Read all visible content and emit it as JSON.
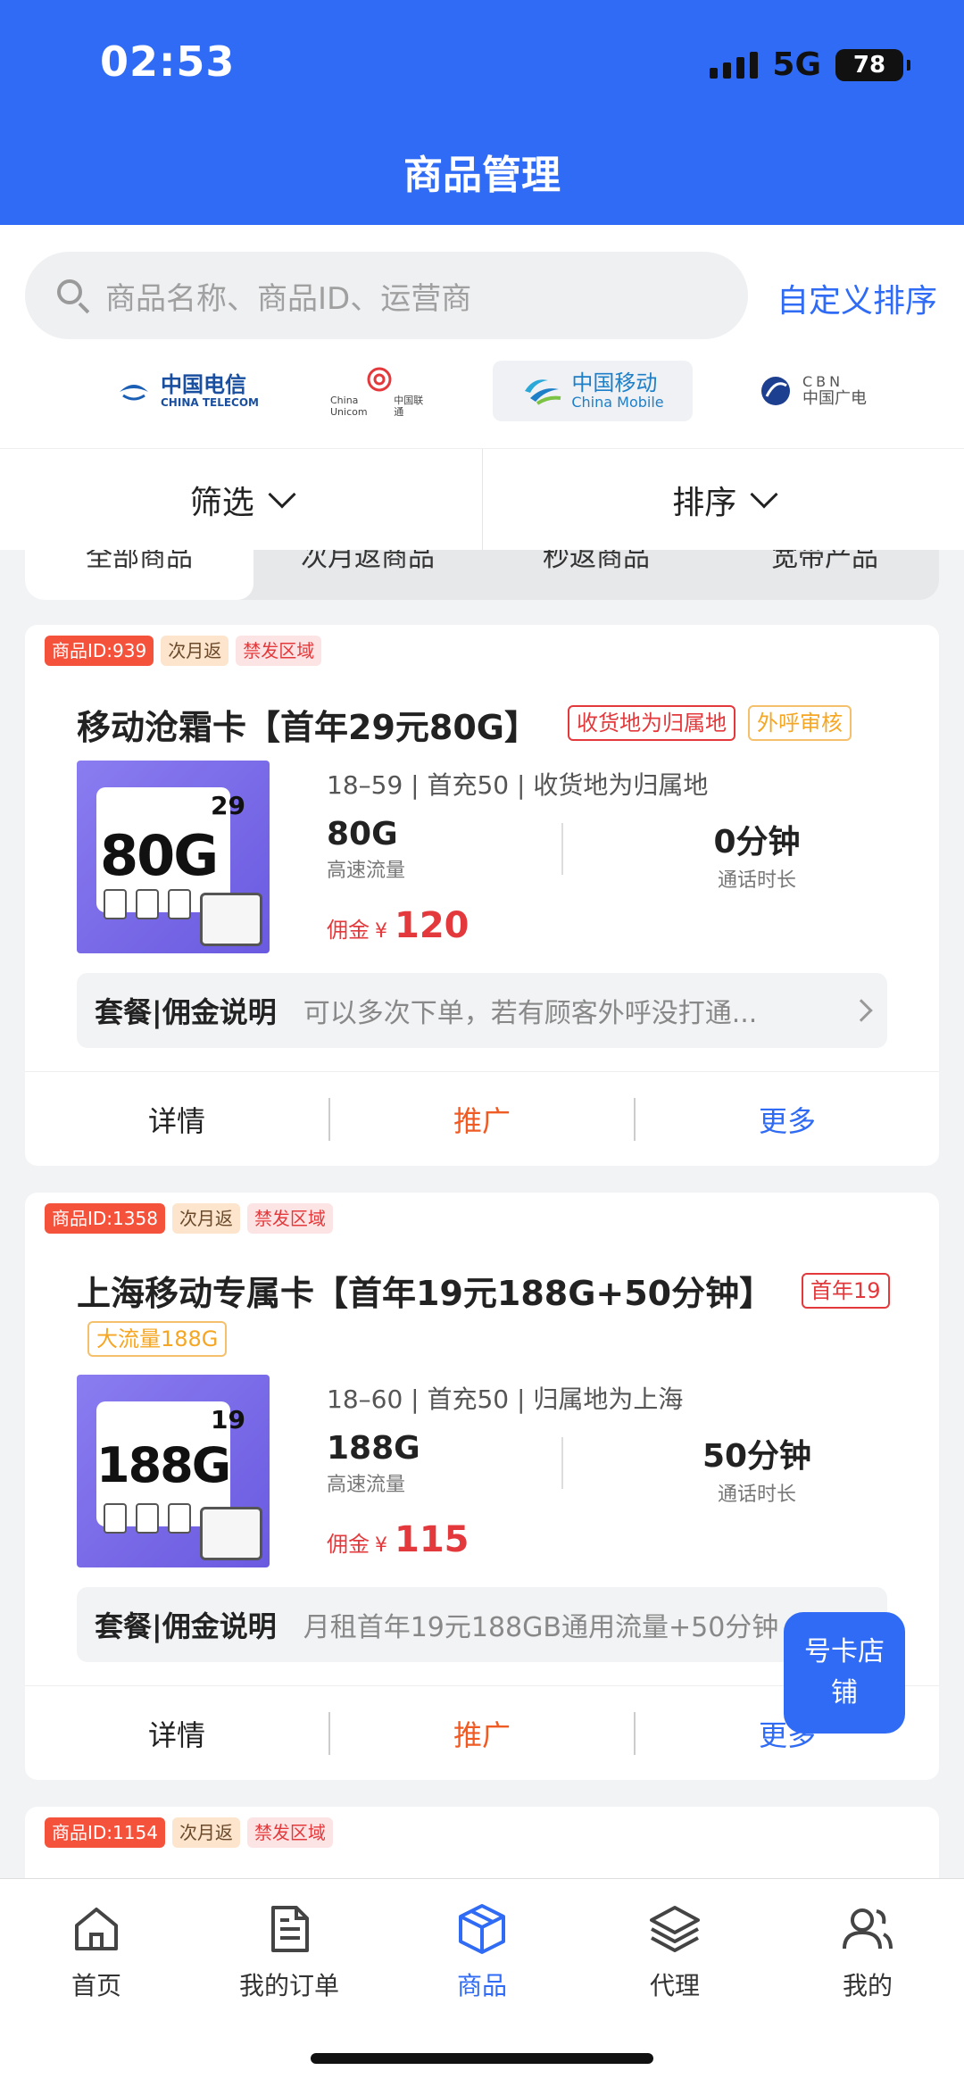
{
  "status_bar": {
    "time": "02:53",
    "network": "5G",
    "battery": "78"
  },
  "header": {
    "title": "商品管理"
  },
  "search": {
    "placeholder": "商品名称、商品ID、运营商",
    "custom_sort": "自定义排序"
  },
  "carriers": [
    {
      "name_cn": "中国电信",
      "name_en": "CHINA TELECOM",
      "selected": false
    },
    {
      "name_cn": "中国联通",
      "name_en": "China Unicom",
      "selected": false
    },
    {
      "name_cn": "中国移动",
      "name_en": "China Mobile",
      "selected": true
    },
    {
      "name_cn": "中国广电",
      "name_en": "CBN",
      "selected": false
    }
  ],
  "filter": {
    "filter_label": "筛选",
    "sort_label": "排序"
  },
  "tabs": [
    {
      "label": "全部商品",
      "active": true
    },
    {
      "label": "次月返商品",
      "active": false
    },
    {
      "label": "秒返商品",
      "active": false
    },
    {
      "label": "宽带产品",
      "active": false
    }
  ],
  "products": [
    {
      "id_tag": "商品ID:939",
      "return_tag": "次月返",
      "ban_tag": "禁发区域",
      "title": "移动沧霜卡【首年29元80G】",
      "badges": [
        "收货地为归属地",
        "外呼审核"
      ],
      "thumb_big": "80G",
      "thumb_price": "29",
      "conditions": "18–59 | 首充50 | 收货地为归属地",
      "data_value": "80G",
      "data_label": "高速流量",
      "call_value": "0分钟",
      "call_label": "通话时长",
      "commission_label": "佣金",
      "currency": "¥",
      "commission": "120",
      "desc_title": "套餐|佣金说明",
      "desc_text": "可以多次下单，若有顾客外呼没打通...",
      "actions": {
        "detail": "详情",
        "promote": "推广",
        "more": "更多"
      }
    },
    {
      "id_tag": "商品ID:1358",
      "return_tag": "次月返",
      "ban_tag": "禁发区域",
      "title": "上海移动专属卡【首年19元188G+50分钟】",
      "badges": [
        "首年19",
        "大流量188G"
      ],
      "thumb_big": "188G",
      "thumb_price": "19",
      "conditions": "18–60 | 首充50 | 归属地为上海",
      "data_value": "188G",
      "data_label": "高速流量",
      "call_value": "50分钟",
      "call_label": "通话时长",
      "commission_label": "佣金",
      "currency": "¥",
      "commission": "115",
      "desc_title": "套餐|佣金说明",
      "desc_text": "月租首年19元188GB通用流量+50分钟",
      "actions": {
        "detail": "详情",
        "promote": "推广",
        "more": "更多"
      }
    },
    {
      "id_tag": "商品ID:1154",
      "return_tag": "次月返",
      "ban_tag": "禁发区域"
    }
  ],
  "float_button": "号卡店铺",
  "tabbar": [
    {
      "label": "首页",
      "icon": "home-icon",
      "active": false
    },
    {
      "label": "我的订单",
      "icon": "document-icon",
      "active": false
    },
    {
      "label": "商品",
      "icon": "box-icon",
      "active": true
    },
    {
      "label": "代理",
      "icon": "layers-icon",
      "active": false
    },
    {
      "label": "我的",
      "icon": "users-icon",
      "active": false
    }
  ],
  "colors": {
    "primary": "#2f6bf5",
    "accent_red": "#e4393c",
    "accent_orange": "#f05a23"
  }
}
